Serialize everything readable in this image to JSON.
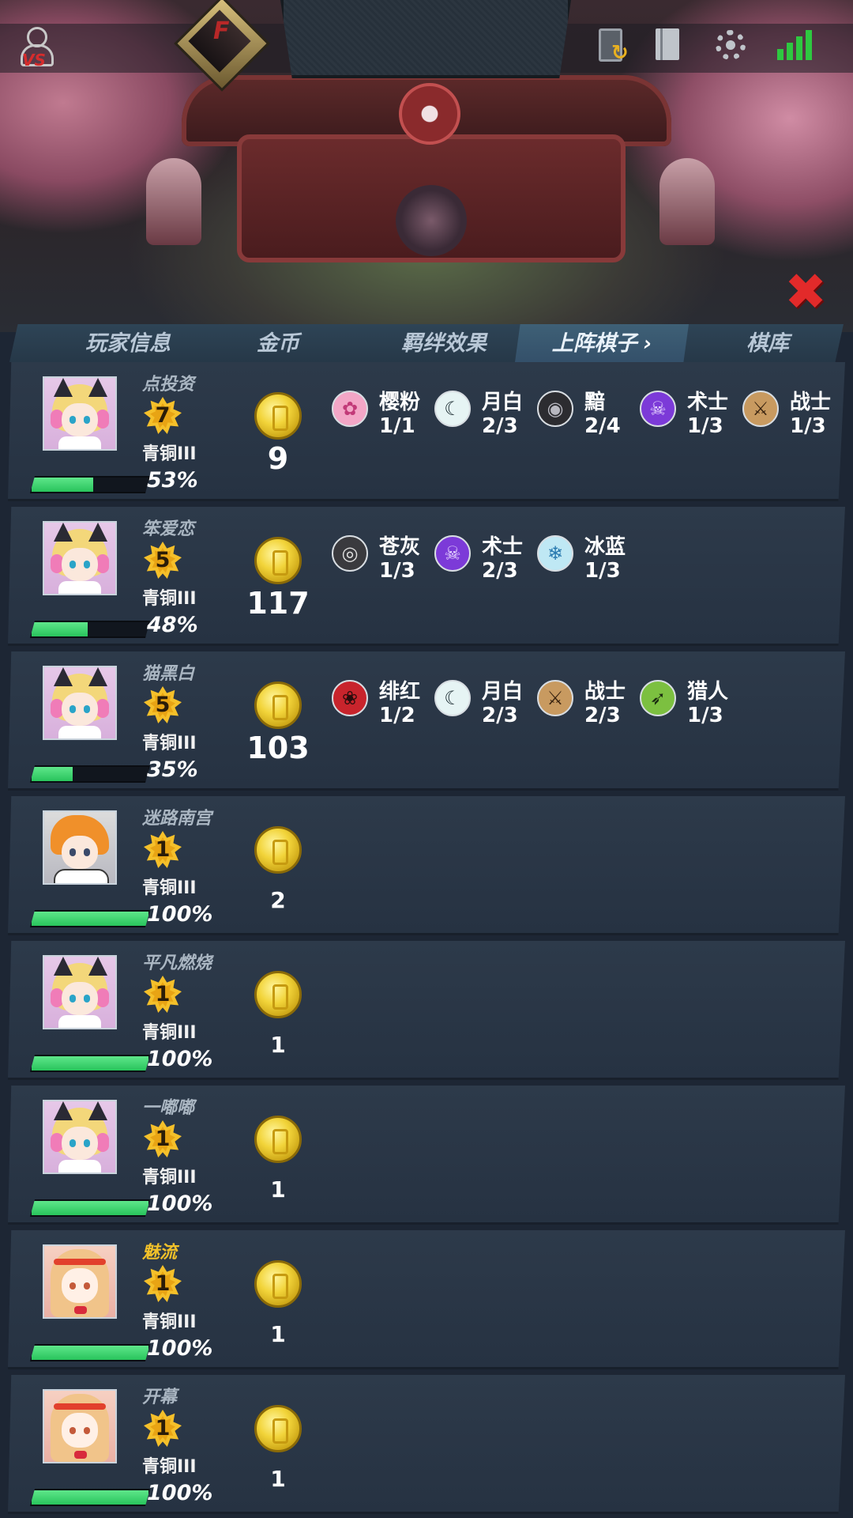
{
  "top": {
    "rank_letter": "F",
    "vs_label": "VS"
  },
  "tabs": [
    {
      "label": "玩家信息"
    },
    {
      "label": "金币"
    },
    {
      "label": "羁绊效果"
    },
    {
      "label": "上阵棋子",
      "active": true
    },
    {
      "label": "棋库"
    }
  ],
  "tab_chevron": "›",
  "close_glyph": "✖",
  "players": [
    {
      "name": "点投资",
      "level": "7",
      "rank": "青铜III",
      "hp": "53%",
      "hp_fraction": 0.53,
      "gold": "9",
      "avatar": "cat-girl",
      "synergies": [
        {
          "name": "樱粉",
          "count": "1/1",
          "icon": "sakura-icon",
          "color": "#f3a6c6"
        },
        {
          "name": "月白",
          "count": "2/3",
          "icon": "moon-icon",
          "color": "#e6f4f4"
        },
        {
          "name": "黯",
          "count": "2/4",
          "icon": "eye-icon",
          "color": "#2c2c30"
        },
        {
          "name": "术士",
          "count": "1/3",
          "icon": "demon-mask-icon",
          "color": "#7c3ad8"
        },
        {
          "name": "战士",
          "count": "1/3",
          "icon": "crossed-weapons-icon",
          "color": "#c89a60"
        }
      ]
    },
    {
      "name": "笨爱恋",
      "level": "5",
      "rank": "青铜III",
      "hp": "48%",
      "hp_fraction": 0.48,
      "gold": "117",
      "avatar": "cat-girl",
      "synergies": [
        {
          "name": "苍灰",
          "count": "1/3",
          "icon": "tomoe-icon",
          "color": "#3a3a3e"
        },
        {
          "name": "术士",
          "count": "2/3",
          "icon": "demon-mask-icon",
          "color": "#7c3ad8"
        },
        {
          "name": "冰蓝",
          "count": "1/3",
          "icon": "snowflake-icon",
          "color": "#bfe8f4"
        }
      ]
    },
    {
      "name": "猫黑白",
      "level": "5",
      "rank": "青铜III",
      "hp": "35%",
      "hp_fraction": 0.35,
      "gold": "103",
      "avatar": "cat-girl",
      "synergies": [
        {
          "name": "绯红",
          "count": "1/2",
          "icon": "rose-icon",
          "color": "#c8242c"
        },
        {
          "name": "月白",
          "count": "2/3",
          "icon": "moon-icon",
          "color": "#e6f4f4"
        },
        {
          "name": "战士",
          "count": "2/3",
          "icon": "crossed-weapons-icon",
          "color": "#c89a60"
        },
        {
          "name": "猎人",
          "count": "1/3",
          "icon": "bow-icon",
          "color": "#7cc040"
        }
      ]
    },
    {
      "name": "迷路南宫",
      "level": "1",
      "rank": "青铜III",
      "hp": "100%",
      "hp_fraction": 1.0,
      "gold": "2",
      "avatar": "orange-hair-boy",
      "synergies": []
    },
    {
      "name": "平凡燃烧",
      "level": "1",
      "rank": "青铜III",
      "hp": "100%",
      "hp_fraction": 1.0,
      "gold": "1",
      "avatar": "cat-girl",
      "synergies": []
    },
    {
      "name": "一嘟嘟",
      "level": "1",
      "rank": "青铜III",
      "hp": "100%",
      "hp_fraction": 1.0,
      "gold": "1",
      "avatar": "cat-girl",
      "synergies": []
    },
    {
      "name": "魅流",
      "name_highlight": true,
      "level": "1",
      "rank": "青铜III",
      "hp": "100%",
      "hp_fraction": 1.0,
      "gold": "1",
      "avatar": "headband-girl",
      "synergies": []
    },
    {
      "name": "开幕",
      "level": "1",
      "rank": "青铜III",
      "hp": "100%",
      "hp_fraction": 1.0,
      "gold": "1",
      "avatar": "headband-girl",
      "synergies": []
    }
  ]
}
